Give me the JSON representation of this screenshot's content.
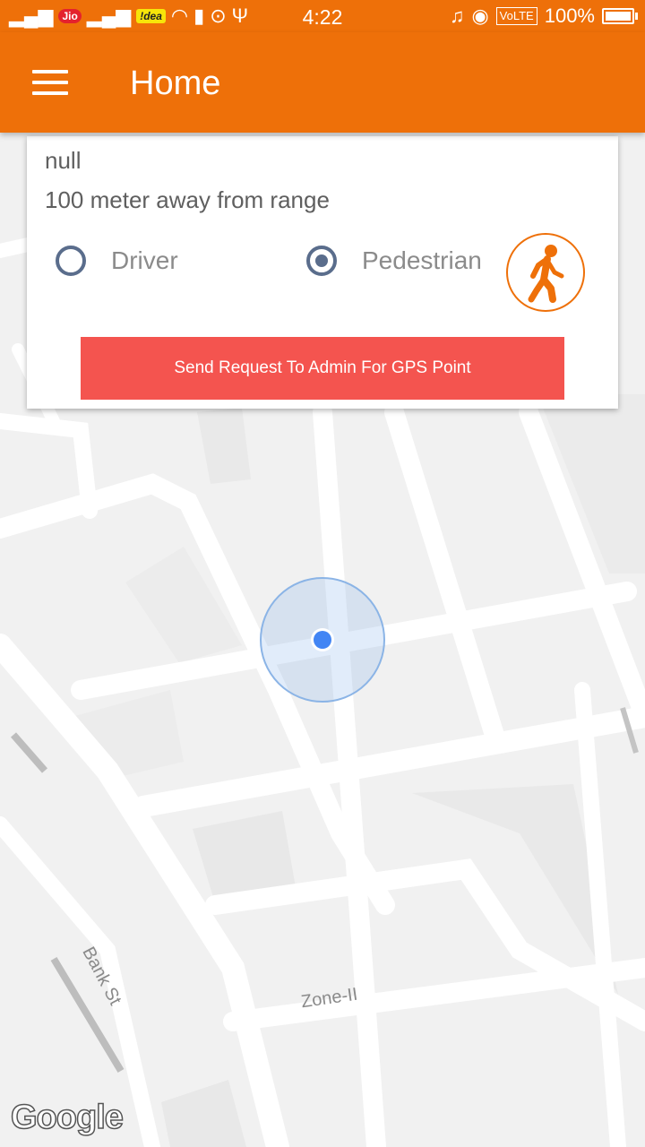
{
  "status_bar": {
    "carrier1": "Jio",
    "carrier2": "!dea",
    "time": "4:22",
    "network": "VoLTE",
    "battery": "100%"
  },
  "app_bar": {
    "title": "Home"
  },
  "card": {
    "line1": "null",
    "line2": "100 meter away from range",
    "options": [
      {
        "label": "Driver",
        "selected": false
      },
      {
        "label": "Pedestrian",
        "selected": true
      }
    ],
    "send_button_label": "Send Request To Admin For GPS Point"
  },
  "map": {
    "street_labels": [
      "Bank St",
      "Zone-II"
    ],
    "attribution": "Google"
  },
  "colors": {
    "primary": "#ee7009",
    "button": "#f4544f",
    "radio": "#5a6d8c",
    "location_dot": "#4285f4"
  }
}
